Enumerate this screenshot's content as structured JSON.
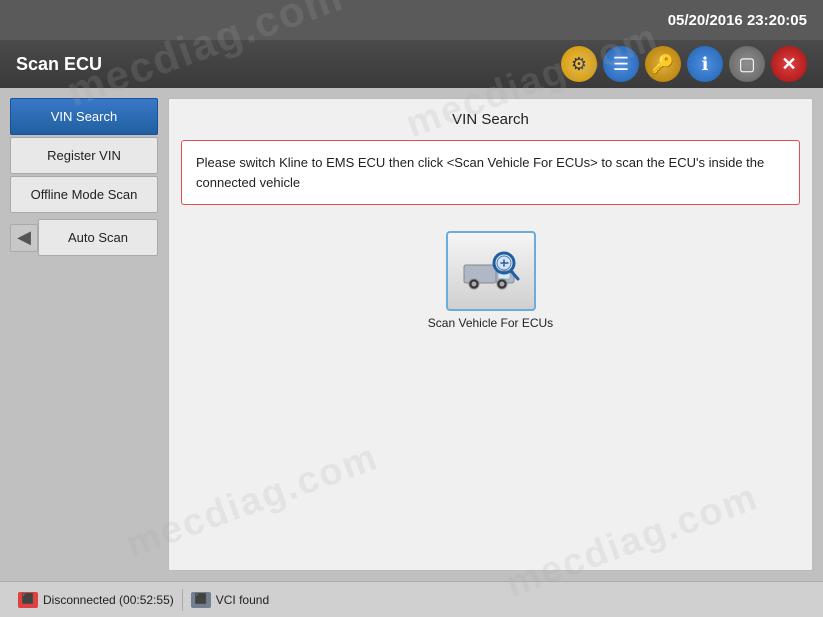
{
  "topbar": {
    "datetime": "05/20/2016 23:20:05"
  },
  "header": {
    "title": "Scan ECU",
    "icons": [
      {
        "name": "settings-icon",
        "symbol": "⚙",
        "class": "icon-settings"
      },
      {
        "name": "list-icon",
        "symbol": "☰",
        "class": "icon-list"
      },
      {
        "name": "key-icon",
        "symbol": "🔑",
        "class": "icon-key"
      },
      {
        "name": "info-icon",
        "symbol": "ℹ",
        "class": "icon-info"
      },
      {
        "name": "window-icon",
        "symbol": "▢",
        "class": "icon-window"
      },
      {
        "name": "close-icon",
        "symbol": "✕",
        "class": "icon-close"
      }
    ]
  },
  "sidebar": {
    "items": [
      {
        "label": "VIN Search",
        "active": true,
        "name": "vin-search"
      },
      {
        "label": "Register VIN",
        "active": false,
        "name": "register-vin"
      },
      {
        "label": "Offline Mode Scan",
        "active": false,
        "name": "offline-mode-scan"
      }
    ],
    "back_label": "◀",
    "auto_scan_label": "Auto Scan"
  },
  "panel": {
    "title": "VIN Search",
    "instruction": "Please switch Kline to EMS ECU then click <Scan Vehicle For ECUs> to scan the ECU's inside the connected vehicle",
    "scan_button_label": "Scan Vehicle For ECUs"
  },
  "statusbar": {
    "disconnected_label": "Disconnected (00:52:55)",
    "vci_label": "VCI found"
  },
  "watermarks": [
    "mecdiag.com",
    "mecdiag.com",
    "mecdiag.com",
    "mecdiag.com"
  ]
}
